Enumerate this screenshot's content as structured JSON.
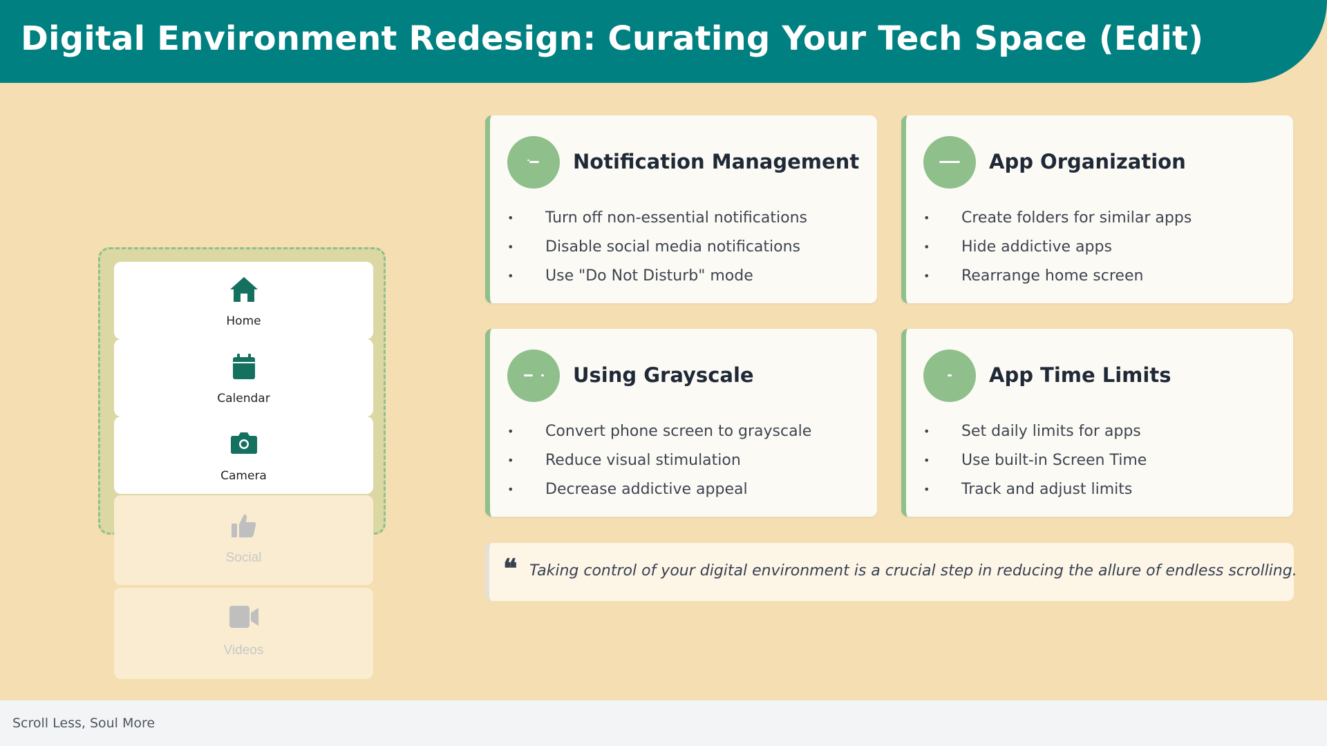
{
  "header": {
    "title": "Digital Environment Redesign: Curating Your Tech Space (Edit)"
  },
  "phone": {
    "apps": [
      {
        "label": "Home",
        "icon": "home-icon"
      },
      {
        "label": "Calendar",
        "icon": "calendar-icon"
      },
      {
        "label": "Camera",
        "icon": "camera-icon"
      },
      {
        "label": "Social",
        "icon": "thumbs-up-icon"
      },
      {
        "label": "Videos",
        "icon": "video-camera-icon"
      }
    ]
  },
  "cards": [
    {
      "title": "Notification Management",
      "items": [
        "Turn off non-essential notifications",
        "Disable social media notifications",
        "Use \"Do Not Disturb\" mode"
      ]
    },
    {
      "title": "App Organization",
      "items": [
        "Create folders for similar apps",
        "Hide addictive apps",
        "Rearrange home screen"
      ]
    },
    {
      "title": "Using Grayscale",
      "items": [
        "Convert phone screen to grayscale",
        "Reduce visual stimulation",
        "Decrease addictive appeal"
      ]
    },
    {
      "title": "App Time Limits",
      "items": [
        "Set daily limits for apps",
        "Use built-in Screen Time",
        "Track and adjust limits"
      ]
    }
  ],
  "bullet_char": "•",
  "quote": {
    "icon": "quote-icon",
    "mark": "❝",
    "text": "Taking control of your digital environment is a crucial step in reducing the allure of endless scrolling."
  },
  "footer": {
    "text": "Scroll Less, Soul More"
  },
  "colors": {
    "header_bg": "#008080",
    "page_bg": "#f4deb2",
    "accent_green": "#8fbf8b",
    "icon_teal": "#14715f",
    "footer_bg": "#f3f4f6"
  }
}
